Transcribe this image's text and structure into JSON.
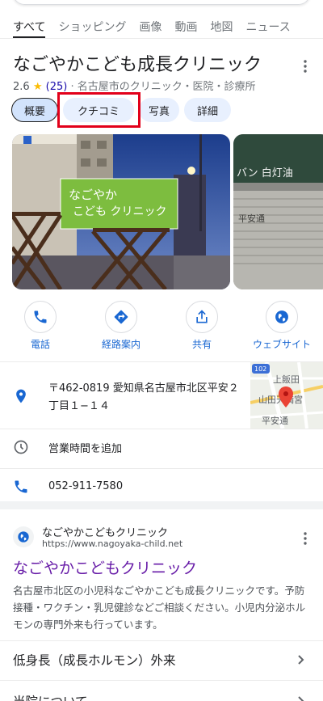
{
  "tabs": [
    "すべて",
    "ショッピング",
    "画像",
    "動画",
    "地図",
    "ニュース"
  ],
  "business": {
    "name": "なごやかこども成長クリニック",
    "rating": "2.6",
    "review_count": "(25)",
    "category": "· 名古屋市のクリニック・医院・診療所"
  },
  "chips": [
    "概要",
    "クチコミ",
    "写真",
    "詳細"
  ],
  "photo_sign": {
    "line1": "なごやか",
    "line2": "こども クリニック"
  },
  "photo2_sign": {
    "top": "バン 白灯油",
    "shutter_text": "平安通"
  },
  "actions": [
    "電話",
    "経路案内",
    "共有",
    "ウェブサイト"
  ],
  "address": "〒462-0819 愛知県名古屋市北区平安２丁目１−１４",
  "map_labels": {
    "road": "102",
    "label1": "上飯田",
    "label2": "山田天満宮",
    "label3": "平安通"
  },
  "hours": "営業時間を追加",
  "phone": "052-911-7580",
  "result": {
    "site_name": "なごやかこどもクリニック",
    "url": "https://www.nagoyaka-child.net",
    "title": "なごやかこどもクリニック",
    "snippet": "名古屋市北区の小児科なごやかこども成長クリニックです。予防接種・ワクチン・乳児健診などご相談ください。小児内分泌ホルモンの専門外来も行っています。"
  },
  "sitelinks": [
    "低身長（成長ホルモン）外来",
    "当院について"
  ],
  "colors": {
    "accent": "#1a73e8",
    "highlight": "#e2001a",
    "visited": "#681da8"
  }
}
